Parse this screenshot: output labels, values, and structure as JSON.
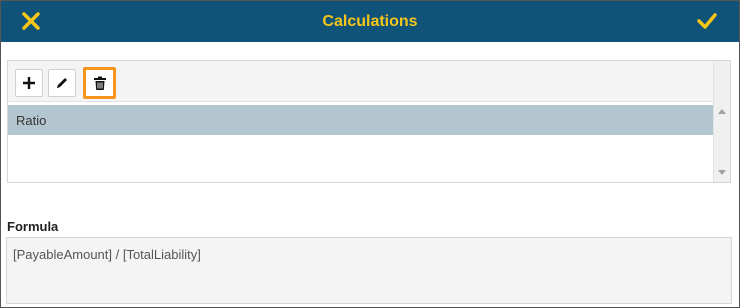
{
  "dialog": {
    "title": "Calculations",
    "header_bg": "#0f5378",
    "accent": "#f5c518"
  },
  "toolbar": {
    "buttons": [
      {
        "name": "add",
        "icon": "plus-icon"
      },
      {
        "name": "edit",
        "icon": "pencil-icon"
      },
      {
        "name": "delete",
        "icon": "trash-icon",
        "highlight_color": "#f7941d"
      }
    ]
  },
  "list": {
    "items": [
      {
        "label": "Ratio",
        "selected": true
      }
    ]
  },
  "formula": {
    "label": "Formula",
    "value": "[PayableAmount] / [TotalLiability]"
  }
}
